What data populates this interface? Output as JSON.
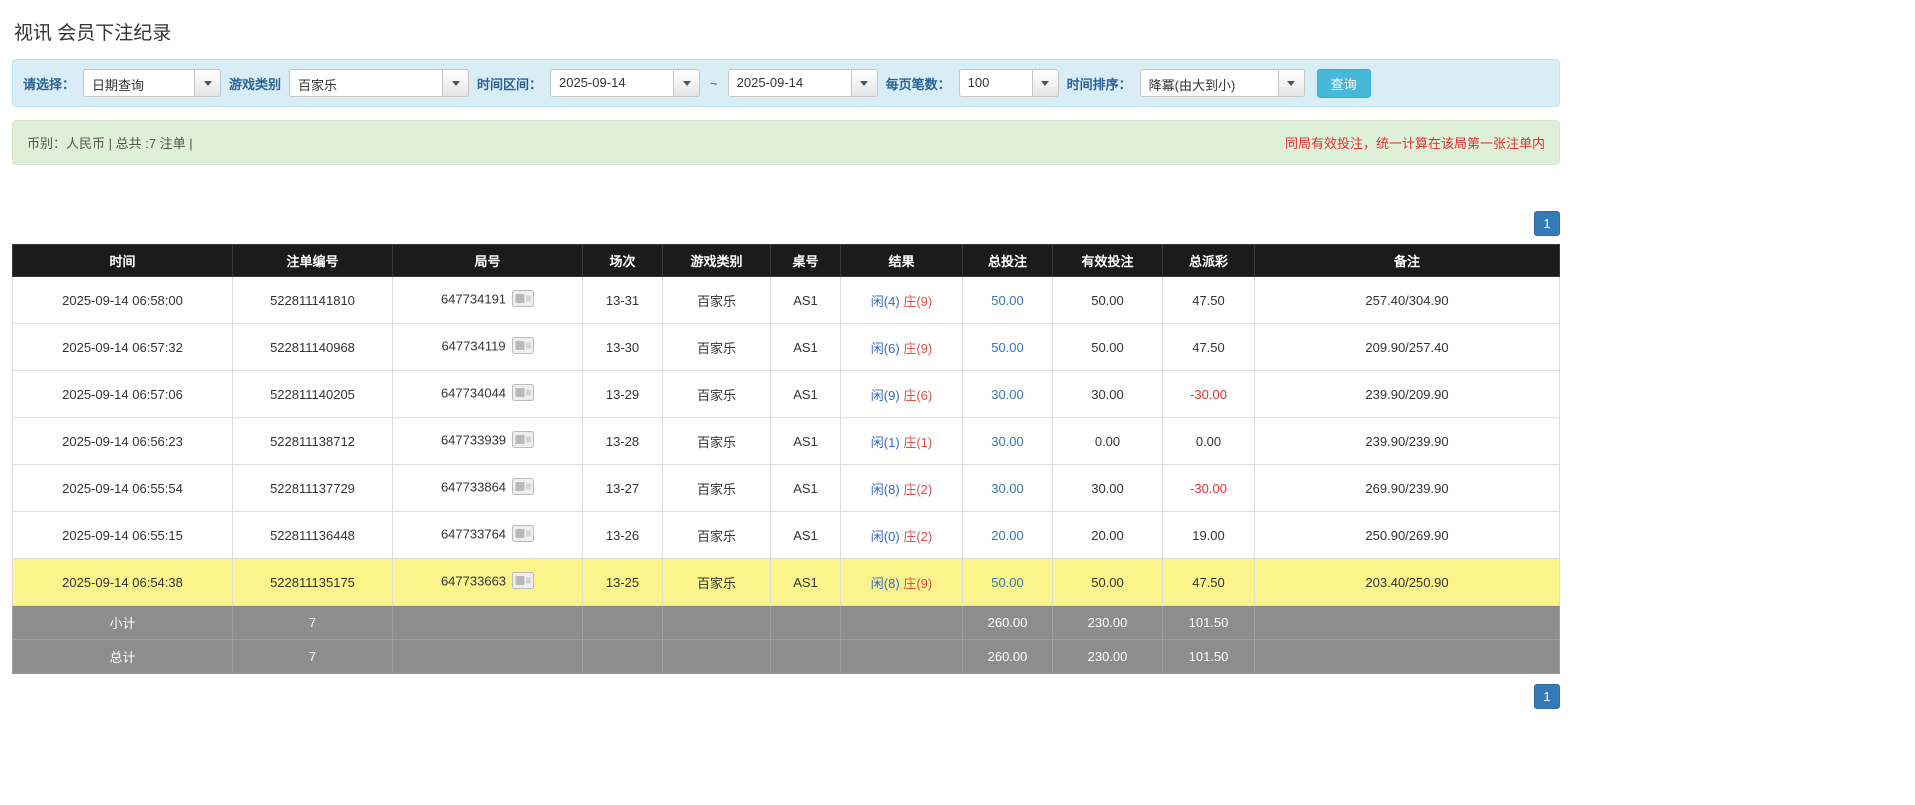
{
  "page": {
    "title": "视讯 会员下注纪录"
  },
  "filters": {
    "select_label": "请选择：",
    "select_value": "日期查询",
    "game_type_label": "游戏类别",
    "game_type_value": "百家乐",
    "date_range_label": "时间区间：",
    "date_from": "2025-09-14",
    "tilde": "~",
    "date_to": "2025-09-14",
    "page_size_label": "每页笔数：",
    "page_size_value": "100",
    "sort_label": "时间排序：",
    "sort_value": "降冪(由大到小)",
    "search_button": "查询"
  },
  "summary": {
    "left": "币别：人民币 | 总共 :7 注单 |",
    "right": "同局有效投注，统一计算在该局第一张注单内"
  },
  "pagination": {
    "page": "1"
  },
  "colors": {
    "accent_blue": "#337ab7",
    "header_dark": "#1b1b1b",
    "highlight_yellow": "#faf48b",
    "negative_red": "#e03030",
    "player_blue": "#3366cc",
    "banker_red": "#d9534f"
  },
  "table": {
    "headers": [
      "时间",
      "注单编号",
      "局号",
      "场次",
      "游戏类别",
      "桌号",
      "结果",
      "总投注",
      "有效投注",
      "总派彩",
      "备注"
    ],
    "rows": [
      {
        "time": "2025-09-14 06:58:00",
        "bet_id": "522811141810",
        "round_id": "647734191",
        "session": "13-31",
        "game": "百家乐",
        "table_no": "AS1",
        "player": "闲(4)",
        "banker": "庄(9)",
        "total_bet": "50.00",
        "valid_bet": "50.00",
        "payout": "47.50",
        "note": "257.40/304.90"
      },
      {
        "time": "2025-09-14 06:57:32",
        "bet_id": "522811140968",
        "round_id": "647734119",
        "session": "13-30",
        "game": "百家乐",
        "table_no": "AS1",
        "player": "闲(6)",
        "banker": "庄(9)",
        "total_bet": "50.00",
        "valid_bet": "50.00",
        "payout": "47.50",
        "note": "209.90/257.40"
      },
      {
        "time": "2025-09-14 06:57:06",
        "bet_id": "522811140205",
        "round_id": "647734044",
        "session": "13-29",
        "game": "百家乐",
        "table_no": "AS1",
        "player": "闲(9)",
        "banker": "庄(6)",
        "total_bet": "30.00",
        "valid_bet": "30.00",
        "payout": "-30.00",
        "note": "239.90/209.90"
      },
      {
        "time": "2025-09-14 06:56:23",
        "bet_id": "522811138712",
        "round_id": "647733939",
        "session": "13-28",
        "game": "百家乐",
        "table_no": "AS1",
        "player": "闲(1)",
        "banker": "庄(1)",
        "total_bet": "30.00",
        "valid_bet": "0.00",
        "payout": "0.00",
        "note": "239.90/239.90"
      },
      {
        "time": "2025-09-14 06:55:54",
        "bet_id": "522811137729",
        "round_id": "647733864",
        "session": "13-27",
        "game": "百家乐",
        "table_no": "AS1",
        "player": "闲(8)",
        "banker": "庄(2)",
        "total_bet": "30.00",
        "valid_bet": "30.00",
        "payout": "-30.00",
        "note": "269.90/239.90"
      },
      {
        "time": "2025-09-14 06:55:15",
        "bet_id": "522811136448",
        "round_id": "647733764",
        "session": "13-26",
        "game": "百家乐",
        "table_no": "AS1",
        "player": "闲(0)",
        "banker": "庄(2)",
        "total_bet": "20.00",
        "valid_bet": "20.00",
        "payout": "19.00",
        "note": "250.90/269.90"
      },
      {
        "time": "2025-09-14 06:54:38",
        "bet_id": "522811135175",
        "round_id": "647733663",
        "session": "13-25",
        "game": "百家乐",
        "table_no": "AS1",
        "player": "闲(8)",
        "banker": "庄(9)",
        "total_bet": "50.00",
        "valid_bet": "50.00",
        "payout": "47.50",
        "note": "203.40/250.90"
      }
    ],
    "subtotal": {
      "label": "小计",
      "count": "7",
      "total_bet": "260.00",
      "valid_bet": "230.00",
      "payout": "101.50"
    },
    "total": {
      "label": "总计",
      "count": "7",
      "total_bet": "260.00",
      "valid_bet": "230.00",
      "payout": "101.50"
    }
  }
}
